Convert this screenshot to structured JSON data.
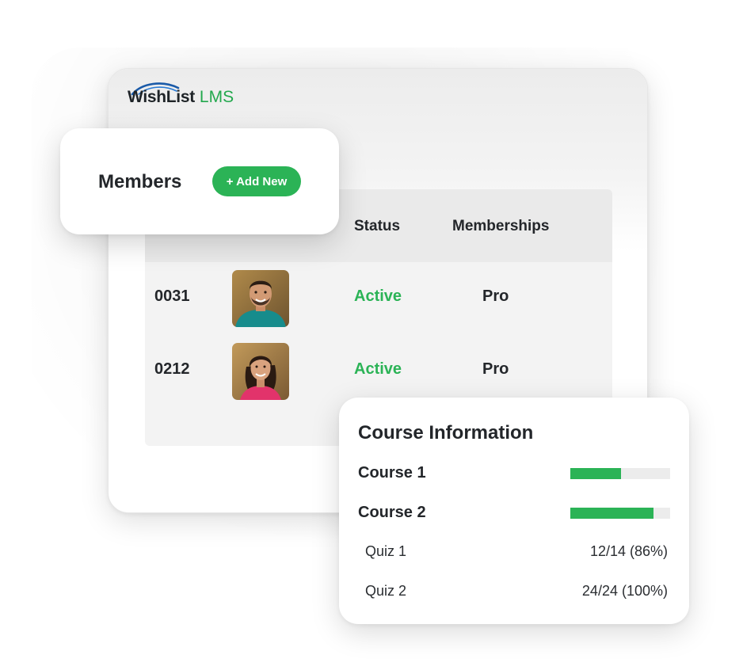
{
  "brand": {
    "name_part1": "WishList",
    "name_part2": "LMS",
    "accent_color": "#2bb356"
  },
  "members_card": {
    "title": "Members",
    "add_button_label": "+ Add New"
  },
  "table": {
    "columns": [
      "Status",
      "Memberships"
    ],
    "rows": [
      {
        "id": "0031",
        "avatar": "member-photo-man",
        "status": "Active",
        "membership": "Pro"
      },
      {
        "id": "0212",
        "avatar": "member-photo-woman",
        "status": "Active",
        "membership": "Pro"
      }
    ]
  },
  "course_info": {
    "title": "Course Information",
    "courses": [
      {
        "name": "Course 1",
        "progress": 0.51
      },
      {
        "name": "Course 2",
        "progress": 0.83
      }
    ],
    "quizzes": [
      {
        "name": "Quiz 1",
        "score": "12/14 (86%)"
      },
      {
        "name": "Quiz 2",
        "score": "24/24 (100%)"
      }
    ]
  }
}
